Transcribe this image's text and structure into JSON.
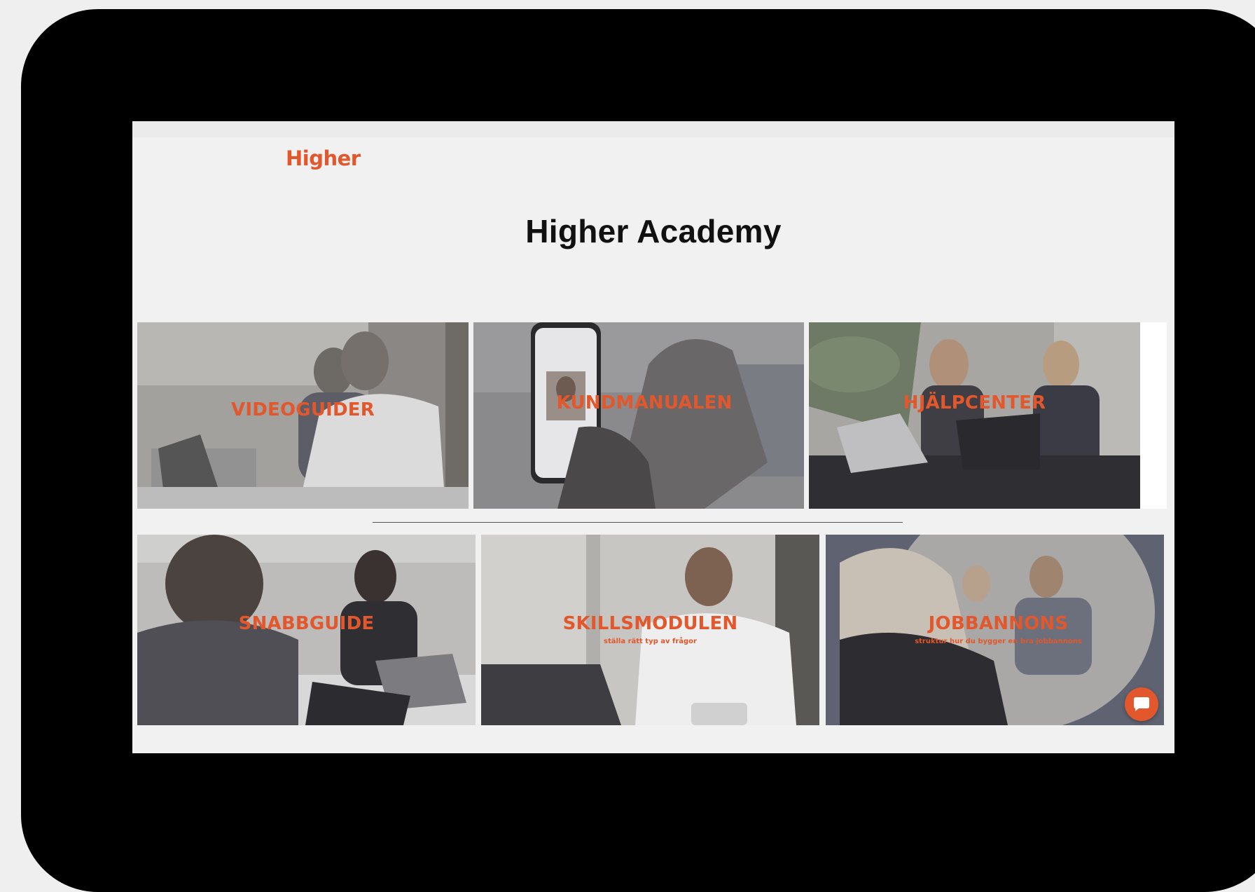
{
  "brand": {
    "logo_text": "Higher",
    "accent_color": "#e2572c"
  },
  "page": {
    "title": "Higher Academy"
  },
  "tiles_row1": [
    {
      "label": "VIDEOGUIDER"
    },
    {
      "label": "KUNDMANUALEN"
    },
    {
      "label": "HJÄLPCENTER"
    }
  ],
  "tiles_row2": [
    {
      "label": "SNABBGUIDE",
      "subtitle": ""
    },
    {
      "label": "SKILLSMODULEN",
      "subtitle": "ställa rätt typ av frågor"
    },
    {
      "label": "JOBBANNONS",
      "subtitle": "struktur hur du bygger en bra jobbannons"
    }
  ],
  "chat": {
    "icon": "chat-bubble-icon"
  }
}
